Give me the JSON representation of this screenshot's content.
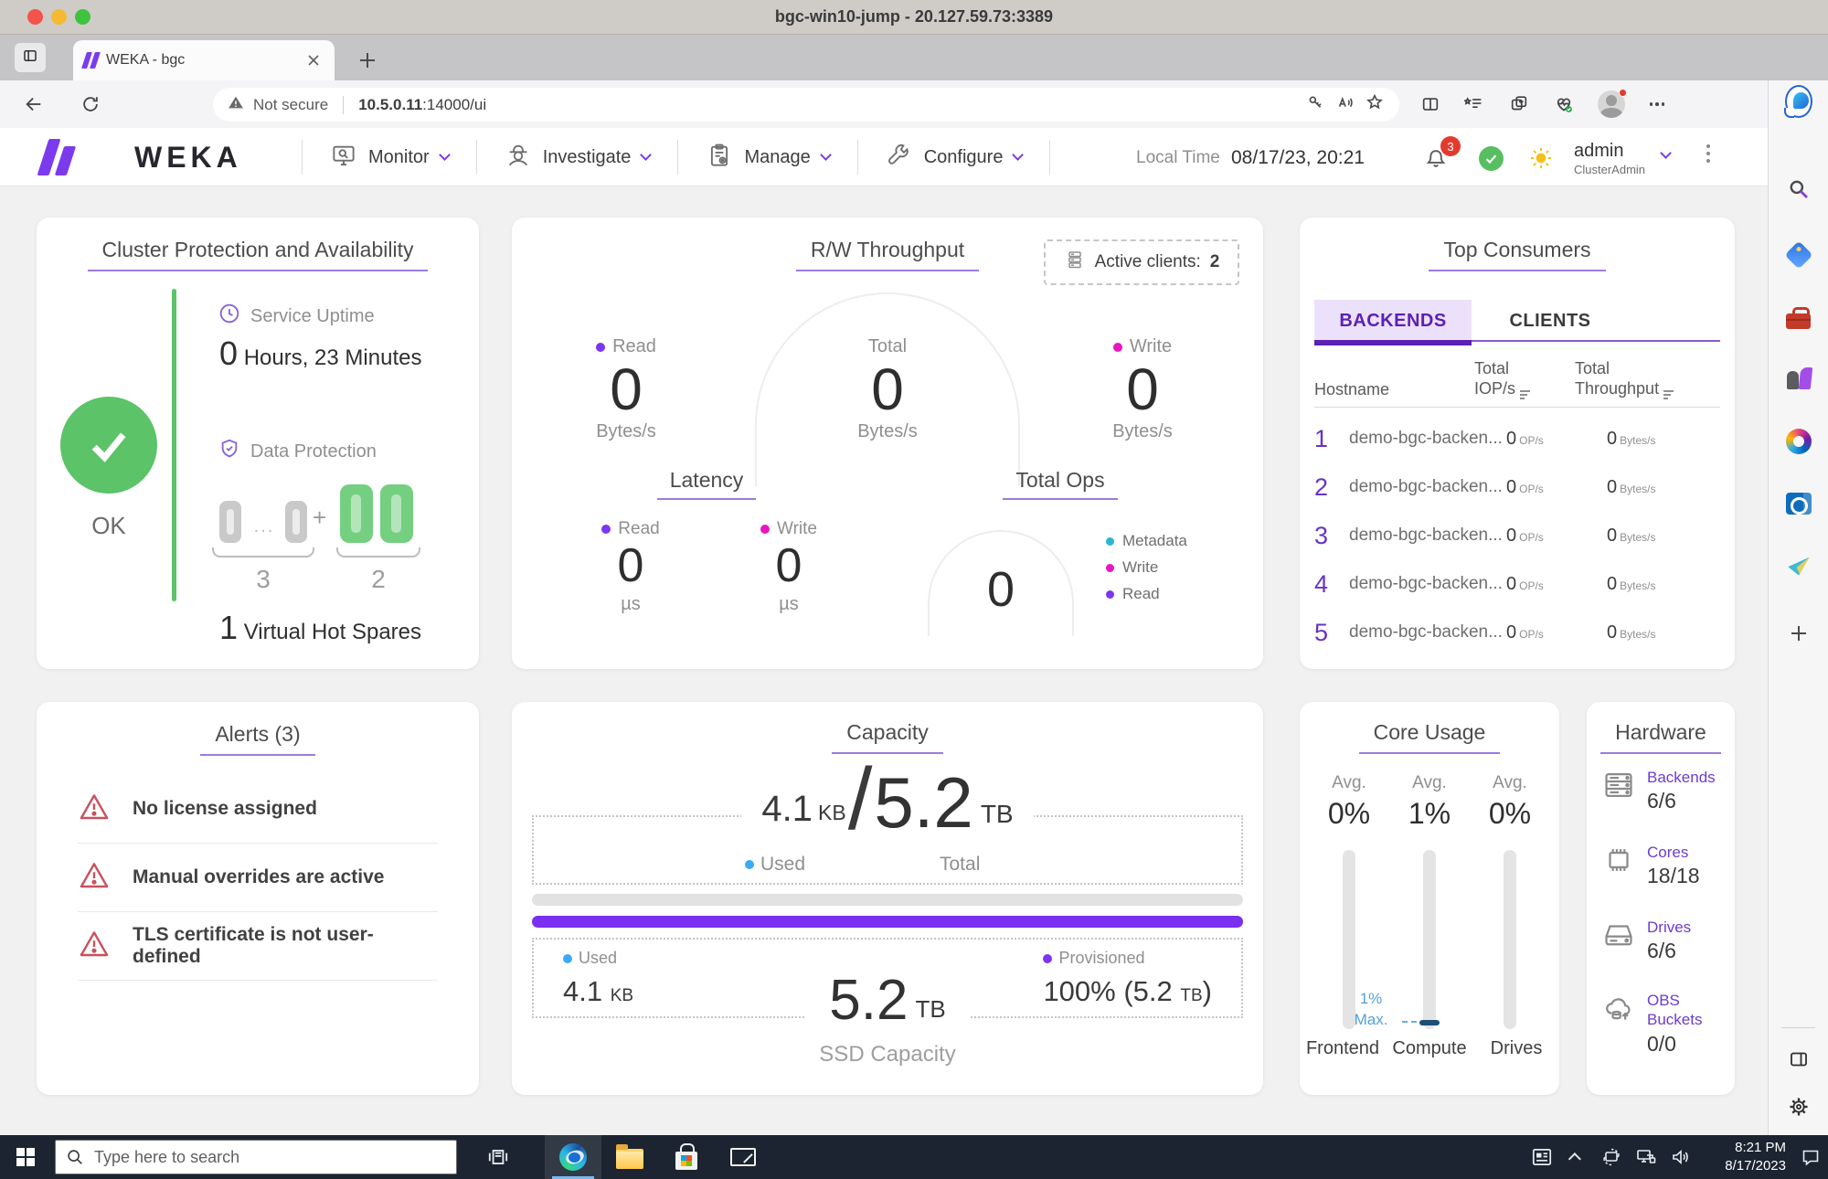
{
  "colors": {
    "accent_purple": "#7c3aed",
    "deep_purple": "#5b21b5",
    "ok_green": "#5cc368",
    "magenta": "#e716c3",
    "teal": "#29b7d3",
    "blue": "#3da9f5",
    "capacity_purple": "#7b2ff0",
    "alert_red": "#c9515d"
  },
  "window": {
    "title": "bgc-win10-jump - 20.127.59.73:3389"
  },
  "browser": {
    "tab_title": "WEKA - bgc",
    "security_label": "Not secure",
    "url_host": "10.5.0.11",
    "url_rest": ":14000/ui"
  },
  "header": {
    "brand": "WEKA",
    "nav": [
      {
        "label": "Monitor"
      },
      {
        "label": "Investigate"
      },
      {
        "label": "Manage"
      },
      {
        "label": "Configure"
      }
    ],
    "local_time_label": "Local Time",
    "local_time_value": "08/17/23, 20:21",
    "notifications_count": "3",
    "user_name": "admin",
    "user_role": "ClusterAdmin"
  },
  "cluster": {
    "title": "Cluster Protection and Availability",
    "status": "OK",
    "uptime_label": "Service Uptime",
    "uptime_value": "0",
    "uptime_text": "Hours, 23 Minutes",
    "protection_label": "Data Protection",
    "drive_dots": "...",
    "data_drives": "3",
    "plus": "+",
    "parity_drives": "2",
    "hot_spares_value": "1",
    "hot_spares_label": "Virtual Hot Spares"
  },
  "throughput": {
    "title": "R/W Throughput",
    "active_clients_label": "Active clients:",
    "active_clients_value": "2",
    "read_label": "Read",
    "read_value": "0",
    "read_unit": "Bytes/s",
    "total_label": "Total",
    "total_value": "0",
    "total_unit": "Bytes/s",
    "write_label": "Write",
    "write_value": "0",
    "write_unit": "Bytes/s"
  },
  "latency": {
    "title": "Latency",
    "read_label": "Read",
    "read_value": "0",
    "read_unit": "µs",
    "write_label": "Write",
    "write_value": "0",
    "write_unit": "µs"
  },
  "total_ops": {
    "title": "Total Ops",
    "value": "0",
    "legend": [
      {
        "label": "Metadata",
        "color": "#29b7d3"
      },
      {
        "label": "Write",
        "color": "#e716c3"
      },
      {
        "label": "Read",
        "color": "#7c36f0"
      }
    ]
  },
  "consumers": {
    "title": "Top Consumers",
    "tabs": [
      {
        "label": "BACKENDS"
      },
      {
        "label": "CLIENTS"
      }
    ],
    "columns": {
      "hostname": "Hostname",
      "iops_line1": "Total",
      "iops_line2": "IOP/s",
      "tp_line1": "Total",
      "tp_line2": "Throughput"
    },
    "rows": [
      {
        "index": "1",
        "hostname": "demo-bgc-backen...",
        "iops": "0",
        "iops_unit": "OP/s",
        "tp": "0",
        "tp_unit": "Bytes/s"
      },
      {
        "index": "2",
        "hostname": "demo-bgc-backen...",
        "iops": "0",
        "iops_unit": "OP/s",
        "tp": "0",
        "tp_unit": "Bytes/s"
      },
      {
        "index": "3",
        "hostname": "demo-bgc-backen...",
        "iops": "0",
        "iops_unit": "OP/s",
        "tp": "0",
        "tp_unit": "Bytes/s"
      },
      {
        "index": "4",
        "hostname": "demo-bgc-backen...",
        "iops": "0",
        "iops_unit": "OP/s",
        "tp": "0",
        "tp_unit": "Bytes/s"
      },
      {
        "index": "5",
        "hostname": "demo-bgc-backen...",
        "iops": "0",
        "iops_unit": "OP/s",
        "tp": "0",
        "tp_unit": "Bytes/s"
      }
    ]
  },
  "alerts": {
    "title": "Alerts (3)",
    "items": [
      {
        "text": "No license assigned"
      },
      {
        "text": "Manual overrides are active"
      },
      {
        "text": "TLS certificate is not user-defined"
      }
    ]
  },
  "capacity": {
    "title": "Capacity",
    "used_value": "4.1",
    "used_unit": "KB",
    "slash": "/",
    "total_value": "5.2",
    "total_unit": "TB",
    "used_label": "Used",
    "total_label": "Total",
    "bar_used_label": "Used",
    "bar_used_value": "4.1",
    "bar_used_unit": "KB",
    "provisioned_label": "Provisioned",
    "provisioned_value": "100% (5.2",
    "provisioned_unit": "TB",
    "provisioned_suffix": ")",
    "ssd_value": "5.2",
    "ssd_unit": "TB",
    "ssd_label": "SSD Capacity"
  },
  "core_usage": {
    "title": "Core Usage",
    "columns": [
      {
        "avg_label": "Avg.",
        "value": "0%",
        "name": "Frontend"
      },
      {
        "avg_label": "Avg.",
        "value": "1%",
        "name": "Compute"
      },
      {
        "avg_label": "Avg.",
        "value": "0%",
        "name": "Drives"
      }
    ],
    "max_label_line1": "1%",
    "max_label_line2": "Max."
  },
  "hardware": {
    "title": "Hardware",
    "items": [
      {
        "name": "Backends",
        "value": "6/6"
      },
      {
        "name": "Cores",
        "value": "18/18"
      },
      {
        "name": "Drives",
        "value": "6/6"
      },
      {
        "name": "OBS Buckets",
        "value": "0/0"
      }
    ]
  },
  "taskbar": {
    "search_placeholder": "Type here to search",
    "time": "8:21 PM",
    "date": "8/17/2023"
  }
}
